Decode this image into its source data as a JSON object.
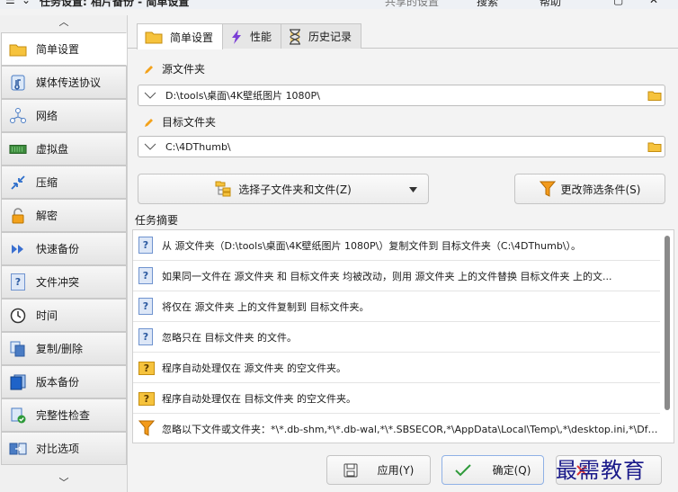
{
  "window": {
    "menu_icon": "hamburger-icon",
    "title": "任务设置: 相片备份 - 简单设置",
    "shared_settings": "共享的设置",
    "search": "搜索",
    "help": "帮助"
  },
  "sidebar": {
    "items": [
      {
        "label": "简单设置",
        "icon": "folder-icon"
      },
      {
        "label": "媒体传送协议",
        "icon": "media-device-icon"
      },
      {
        "label": "网络",
        "icon": "network-icon"
      },
      {
        "label": "虚拟盘",
        "icon": "virtual-disk-icon"
      },
      {
        "label": "压缩",
        "icon": "compress-icon"
      },
      {
        "label": "解密",
        "icon": "lock-icon"
      },
      {
        "label": "快速备份",
        "icon": "fast-forward-icon"
      },
      {
        "label": "文件冲突",
        "icon": "conflict-icon"
      },
      {
        "label": "时间",
        "icon": "clock-icon"
      },
      {
        "label": "复制/删除",
        "icon": "copy-delete-icon"
      },
      {
        "label": "版本备份",
        "icon": "version-icon"
      },
      {
        "label": "完整性检查",
        "icon": "integrity-icon"
      },
      {
        "label": "对比选项",
        "icon": "compare-icon"
      }
    ]
  },
  "tabs": [
    {
      "label": "简单设置",
      "icon": "folder-icon"
    },
    {
      "label": "性能",
      "icon": "lightning-icon"
    },
    {
      "label": "历史记录",
      "icon": "hourglass-icon"
    }
  ],
  "source": {
    "label": "源文件夹",
    "path": "D:\\tools\\桌面\\4K壁纸图片 1080P\\"
  },
  "target": {
    "label": "目标文件夹",
    "path": "C:\\4DThumb\\"
  },
  "buttons": {
    "select_subfolders": "选择子文件夹和文件(Z)",
    "change_filter": "更改筛选条件(S)",
    "apply": "应用(Y)",
    "ok": "确定(Q)"
  },
  "summary": {
    "title": "任务摘要",
    "rows": [
      {
        "text": "从 源文件夹（D:\\tools\\桌面\\4K壁纸图片 1080P\\）复制文件到 目标文件夹（C:\\4DThumb\\）。",
        "icon": "question-icon"
      },
      {
        "text": "如果同一文件在 源文件夹 和 目标文件夹 均被改动，则用 源文件夹 上的文件替换 目标文件夹 上的文...",
        "icon": "question-icon"
      },
      {
        "text": "将仅在 源文件夹 上的文件复制到 目标文件夹。",
        "icon": "question-icon"
      },
      {
        "text": "忽略只在 目标文件夹 的文件。",
        "icon": "question-icon"
      },
      {
        "text": "程序自动处理仅在 源文件夹 的空文件夹。",
        "icon": "folder-question-icon"
      },
      {
        "text": "程序自动处理仅在 目标文件夹 的空文件夹。",
        "icon": "folder-question-icon"
      },
      {
        "text": "忽略以下文件或文件夹：*\\*.db-shm,*\\*.db-wal,*\\*.SBSECOR,*\\AppData\\Local\\Temp\\,*\\desktop.ini,*\\DfsrP...",
        "icon": "filter-icon"
      }
    ]
  },
  "watermark": "最需教育",
  "colors": {
    "accent_orange": "#f3a21b",
    "folder_yellow": "#f6c33d",
    "question_blue": "#6f93cf",
    "ok_green": "#2e9a3a"
  }
}
